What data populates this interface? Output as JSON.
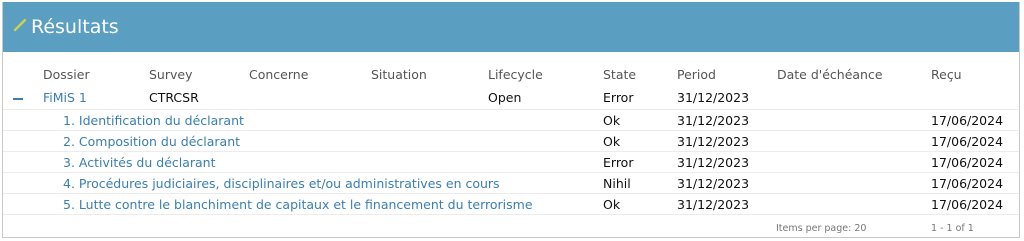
{
  "header": {
    "title": "Résultats",
    "icon": "pencil-icon",
    "bg_color": "#5a9ec2",
    "icon_color": "#c8d44a"
  },
  "columns": [
    "Dossier",
    "Survey",
    "Concerne",
    "Situation",
    "Lifecycle",
    "State",
    "Period",
    "Date d'échéance",
    "Reçu"
  ],
  "group": {
    "dossier": "FiMiS 1",
    "survey": "CTRCSR",
    "lifecycle": "Open",
    "state": "Error",
    "period": "31/12/2023"
  },
  "rows": [
    {
      "label": "1. Identification du déclarant",
      "state": "Ok",
      "period": "31/12/2023",
      "recu": "17/06/2024"
    },
    {
      "label": "2. Composition du déclarant",
      "state": "Ok",
      "period": "31/12/2023",
      "recu": "17/06/2024"
    },
    {
      "label": "3. Activités du déclarant",
      "state": "Error",
      "period": "31/12/2023",
      "recu": "17/06/2024"
    },
    {
      "label": "4. Procédures judiciaires, disciplinaires et/ou administratives en cours",
      "state": "Nihil",
      "period": "31/12/2023",
      "recu": "17/06/2024"
    },
    {
      "label": "5. Lutte contre le blanchiment de capitaux et le financement du terrorisme",
      "state": "Ok",
      "period": "31/12/2023",
      "recu": "17/06/2024"
    }
  ],
  "footer": {
    "items_per_page": "Items per page: 20",
    "pagination": "1 - 1 of 1"
  }
}
